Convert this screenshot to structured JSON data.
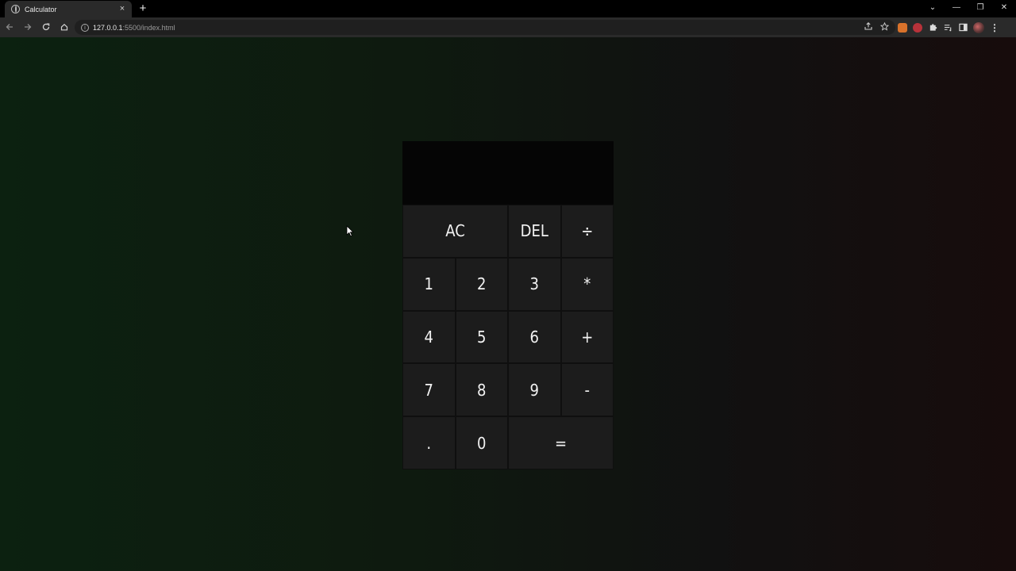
{
  "browser": {
    "tab_title": "Calculator",
    "tab_close": "×",
    "new_tab": "+",
    "url_host": "127.0.0.1",
    "url_path": ":5500/index.html",
    "window_controls": [
      "⌄",
      "—",
      "❐",
      "✕"
    ]
  },
  "calculator": {
    "previous_operand": "",
    "current_operand": "",
    "keys": {
      "ac": "AC",
      "del": "DEL",
      "divide": "÷",
      "one": "1",
      "two": "2",
      "three": "3",
      "multiply": "*",
      "four": "4",
      "five": "5",
      "six": "6",
      "plus": "+",
      "seven": "7",
      "eight": "8",
      "nine": "9",
      "minus": "-",
      "dot": ".",
      "zero": "0",
      "equals": "="
    }
  },
  "colors": {
    "page_gradient_left": "#0c2110",
    "page_gradient_right": "#170c0c",
    "key_bg": "#1c1c1c",
    "display_bg": "#050505"
  }
}
